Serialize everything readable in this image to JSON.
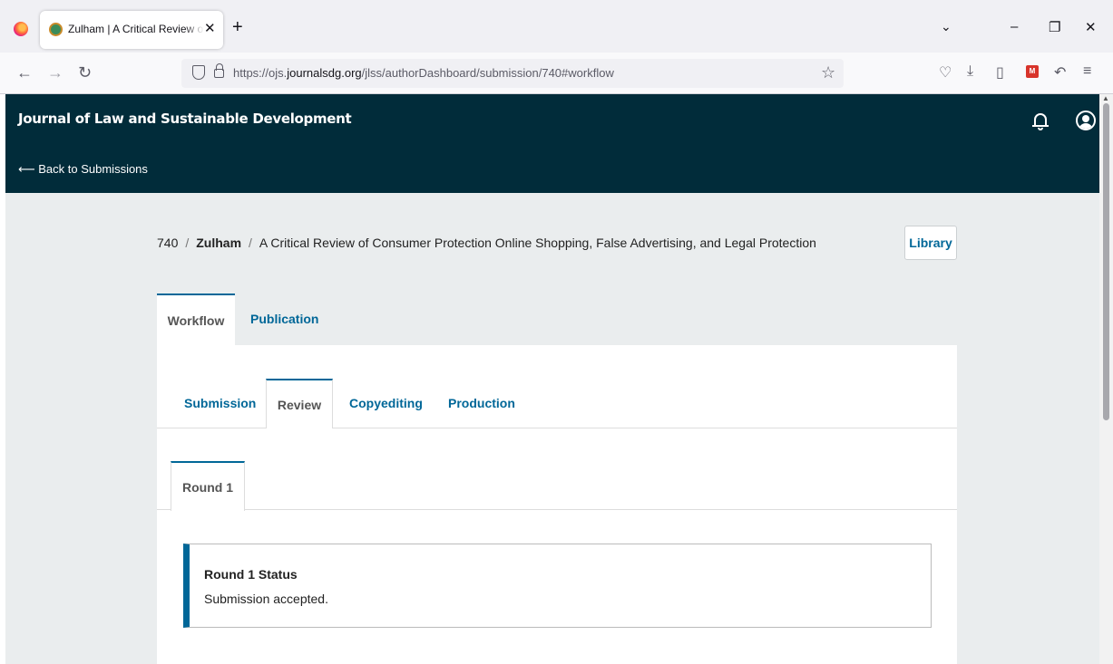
{
  "browser": {
    "tab_title": "Zulham | A Critical Review of Consumer Protection Online Shopping",
    "tab_close": "✕",
    "new_tab": "+",
    "url_prefix": "https://ojs.",
    "url_domain": "journalsdg.org",
    "url_path": "/jlss/authorDashboard/submission/740#workflow"
  },
  "header": {
    "journal_title": "Journal of Law and Sustainable Development",
    "back_link": "⟵ Back to Submissions"
  },
  "breadcrumb": {
    "submission_id": "740",
    "separator": "/",
    "author": "Zulham",
    "title": "A Critical Review of Consumer Protection Online Shopping, False Advertising, and Legal Protection"
  },
  "library_button": "Library",
  "main_tabs": [
    {
      "label": "Workflow",
      "active": true
    },
    {
      "label": "Publication",
      "active": false
    }
  ],
  "workflow_tabs": [
    {
      "label": "Submission",
      "active": false
    },
    {
      "label": "Review",
      "active": true
    },
    {
      "label": "Copyediting",
      "active": false
    },
    {
      "label": "Production",
      "active": false
    }
  ],
  "rounds": [
    {
      "label": "Round 1",
      "active": true
    }
  ],
  "round_status": {
    "title": "Round 1 Status",
    "text": "Submission accepted."
  },
  "colors": {
    "header_bg": "#012c3a",
    "accent": "#006798",
    "content_bg": "#eaedee"
  },
  "icons": [
    "firefox-logo-icon",
    "favicon-icon",
    "back-arrow-icon",
    "forward-arrow-icon",
    "reload-icon",
    "shield-icon",
    "lock-icon",
    "bookmark-star-icon",
    "pocket-icon",
    "download-icon",
    "reader-icon",
    "extension-icon",
    "share-icon",
    "menu-icon",
    "bell-icon",
    "user-icon"
  ]
}
